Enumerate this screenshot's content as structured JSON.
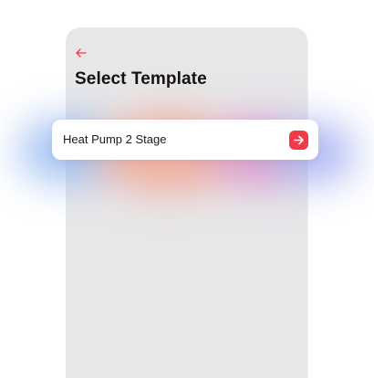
{
  "header": {
    "back_icon": "arrow-left-icon",
    "title": "Select Template"
  },
  "templates": [
    {
      "label": "Heat Pump 2 Stage",
      "action_icon": "arrow-right-icon"
    }
  ],
  "colors": {
    "accent": "#ee3b4a",
    "screen_background": "#e7e7e9",
    "card_background": "#ffffff"
  }
}
